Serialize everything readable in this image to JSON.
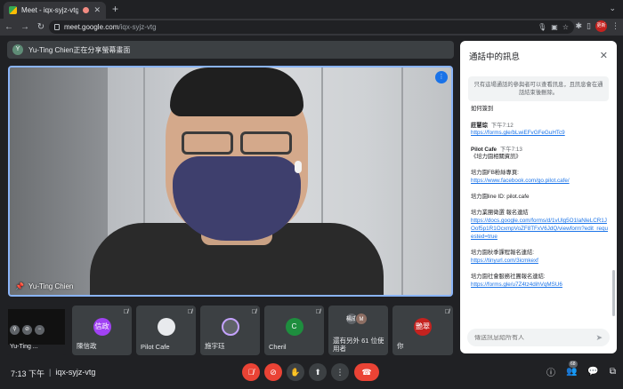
{
  "browser": {
    "tab_title": "Meet - iqx-syjz-vtg",
    "tab_close": "✕",
    "new_tab": "+",
    "url_host": "meet.google.com",
    "url_path": "/iqx-syjz-vtg",
    "profile_label": "更新",
    "menu": "⌄"
  },
  "share_banner": {
    "avatar_letter": "Y",
    "text": "Yu-Ting Chien正在分享螢幕畫面"
  },
  "main_video": {
    "name": "Yu-Ting Chien"
  },
  "tiles": {
    "self_name": "Yu-Ting ...",
    "items": [
      {
        "name": "陳信政",
        "avatar": "信政",
        "color": "#a142f4"
      },
      {
        "name": "Pilot Cafe",
        "avatar": "",
        "color": "#e8eaed"
      },
      {
        "name": "施宇珏",
        "avatar": "",
        "color": "#5f6368"
      },
      {
        "name": "Cheril",
        "avatar": "C",
        "color": "#1e8e3e"
      },
      {
        "name": "還有另外 61 位使用者",
        "avatar": "",
        "color": "#5f6368"
      },
      {
        "name": "你",
        "avatar": "艷翠",
        "color": "#c5221f"
      }
    ],
    "more_avatar_1": "楊成",
    "more_avatar_2": "M"
  },
  "bottom": {
    "time": "7:13 下午",
    "separator": "|",
    "meeting_code": "iqx-syjz-vtg",
    "participant_count": "68"
  },
  "chat": {
    "title": "通話中的訊息",
    "notice": "只有這場通話的參與者可以查看訊息，且訊息會在通話結束後刪除。",
    "input_placeholder": "傳送訊息給所有人",
    "m0": "如何簽到",
    "m1_sender": "莊慧琮",
    "m1_time": "下午7:12",
    "m1_link": "https://forms.gle/bLwiEFvGFeGuHTc9",
    "m2_sender": "Pilot Cafe",
    "m2_time": "下午7:13",
    "m2_l1": "《培力園相關資訊》",
    "m2_l2": "培力園FB粉絲專頁:",
    "m2_l3": "https://www.facebook.com/go.pilot.cafe/",
    "m2_l4": "培力園line ID: pilot.cafe",
    "m2_l5": "培力業團徵選 報名連結",
    "m2_l6": "https://docs.google.com/forms/d/1vUlg5O1IaNleLCR1JOof5p1R1OcxmpVoZF8TFxV6JdQ/viewform?edit_requested=true",
    "m2_l7": "培力園秋季課程報名連結:",
    "m2_l8": "https://tinyurl.com/3icmkexf",
    "m2_l9": "培力園社會服務社團報名連結:",
    "m2_l10": "https://forms.gle/u7Z4tz4dihVqMSU6"
  }
}
